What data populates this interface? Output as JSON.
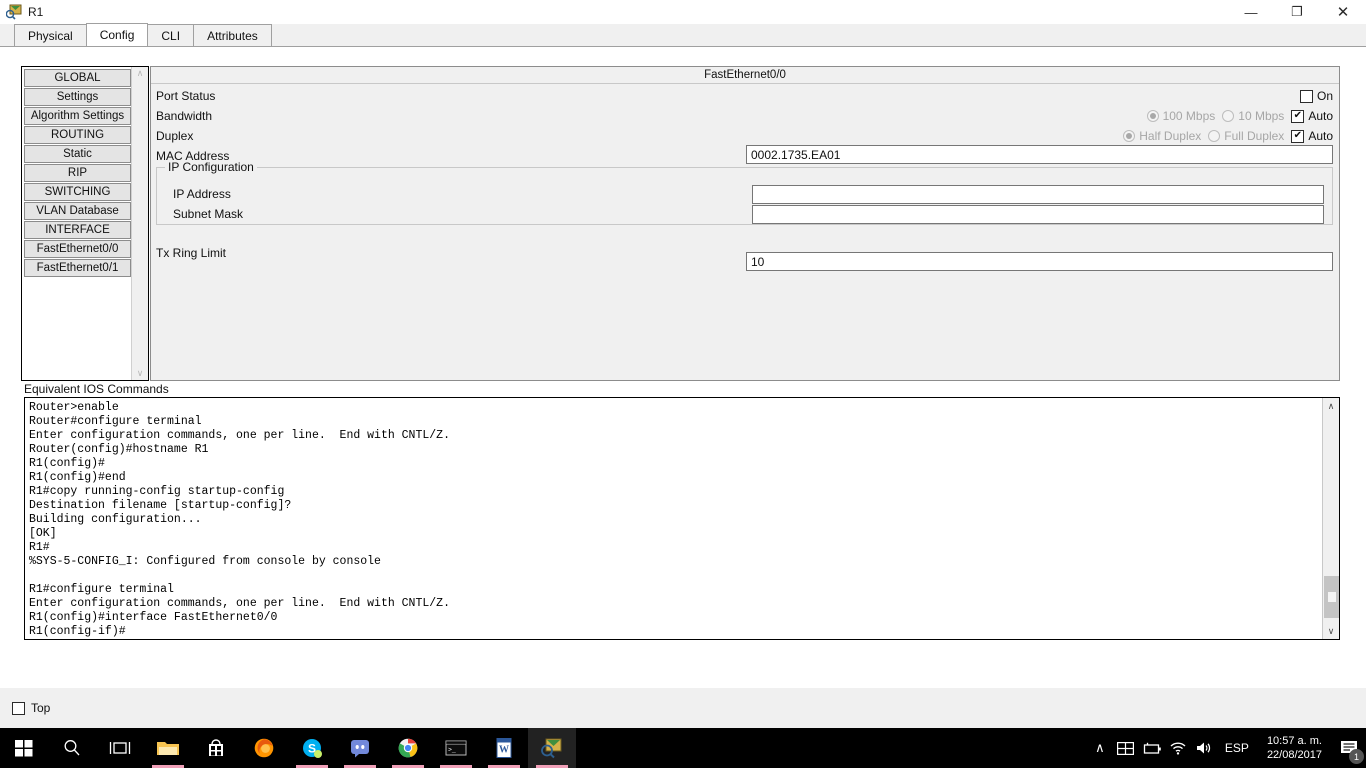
{
  "window": {
    "title": "R1",
    "icon": "packet-tracer-router-icon",
    "minimize": "—",
    "maximize": "❐",
    "close": "✕"
  },
  "tabs": [
    {
      "label": "Physical",
      "active": false
    },
    {
      "label": "Config",
      "active": true
    },
    {
      "label": "CLI",
      "active": false
    },
    {
      "label": "Attributes",
      "active": false
    }
  ],
  "sidebar": {
    "items": [
      {
        "label": "GLOBAL"
      },
      {
        "label": "Settings"
      },
      {
        "label": "Algorithm Settings"
      },
      {
        "label": "ROUTING"
      },
      {
        "label": "Static"
      },
      {
        "label": "RIP"
      },
      {
        "label": "SWITCHING"
      },
      {
        "label": "VLAN Database"
      },
      {
        "label": "INTERFACE"
      },
      {
        "label": "FastEthernet0/0"
      },
      {
        "label": "FastEthernet0/1"
      }
    ],
    "scroll_up": "∧",
    "scroll_down": "∨"
  },
  "panel": {
    "header": "FastEthernet0/0",
    "port_status": {
      "label": "Port Status",
      "on_label": "On",
      "on_checked": false
    },
    "bandwidth": {
      "label": "Bandwidth",
      "opt_100": "100 Mbps",
      "opt_10": "10 Mbps",
      "auto_label": "Auto",
      "selected": "100 Mbps",
      "auto_checked": true
    },
    "duplex": {
      "label": "Duplex",
      "opt_half": "Half Duplex",
      "opt_full": "Full Duplex",
      "auto_label": "Auto",
      "selected": "Half Duplex",
      "auto_checked": true
    },
    "mac": {
      "label": "MAC Address",
      "value": "0002.1735.EA01"
    },
    "ip_config": {
      "title": "IP Configuration",
      "ip_label": "IP Address",
      "ip_value": "",
      "mask_label": "Subnet Mask",
      "mask_value": ""
    },
    "tx_ring": {
      "label": "Tx Ring Limit",
      "value": "10"
    }
  },
  "ios": {
    "label": "Equivalent IOS Commands",
    "text": "Router>enable\nRouter#configure terminal\nEnter configuration commands, one per line.  End with CNTL/Z.\nRouter(config)#hostname R1\nR1(config)#\nR1(config)#end\nR1#copy running-config startup-config\nDestination filename [startup-config]?\nBuilding configuration...\n[OK]\nR1#\n%SYS-5-CONFIG_I: Configured from console by console\n\nR1#configure terminal\nEnter configuration commands, one per line.  End with CNTL/Z.\nR1(config)#interface FastEthernet0/0\nR1(config-if)#",
    "scroll_up": "∧",
    "scroll_down": "∨"
  },
  "bottom": {
    "top_label": "Top",
    "top_checked": false
  },
  "taskbar": {
    "icons": [
      {
        "name": "start-button",
        "running": false
      },
      {
        "name": "search-icon",
        "running": false
      },
      {
        "name": "task-view-icon",
        "running": false
      },
      {
        "name": "file-explorer-icon",
        "running": true
      },
      {
        "name": "microsoft-store-icon",
        "running": false
      },
      {
        "name": "firefox-icon",
        "running": false
      },
      {
        "name": "skype-icon",
        "running": true
      },
      {
        "name": "discord-icon",
        "running": true
      },
      {
        "name": "chrome-icon",
        "running": true
      },
      {
        "name": "command-prompt-icon",
        "running": true
      },
      {
        "name": "word-icon",
        "running": true
      },
      {
        "name": "packet-tracer-icon",
        "running": true
      }
    ],
    "tray": {
      "show_hidden": "∧",
      "language": "ESP",
      "time": "10:57 a. m.",
      "date": "22/08/2017",
      "notification_count": "1"
    }
  },
  "colors": {
    "window_bg": "#ffffff",
    "panel_bg": "#f0f0f0",
    "button_face": "#e4e4e4",
    "border": "#8c8c8c",
    "taskbar_bg": "#000000",
    "running_underline": "#f0a0b8"
  }
}
